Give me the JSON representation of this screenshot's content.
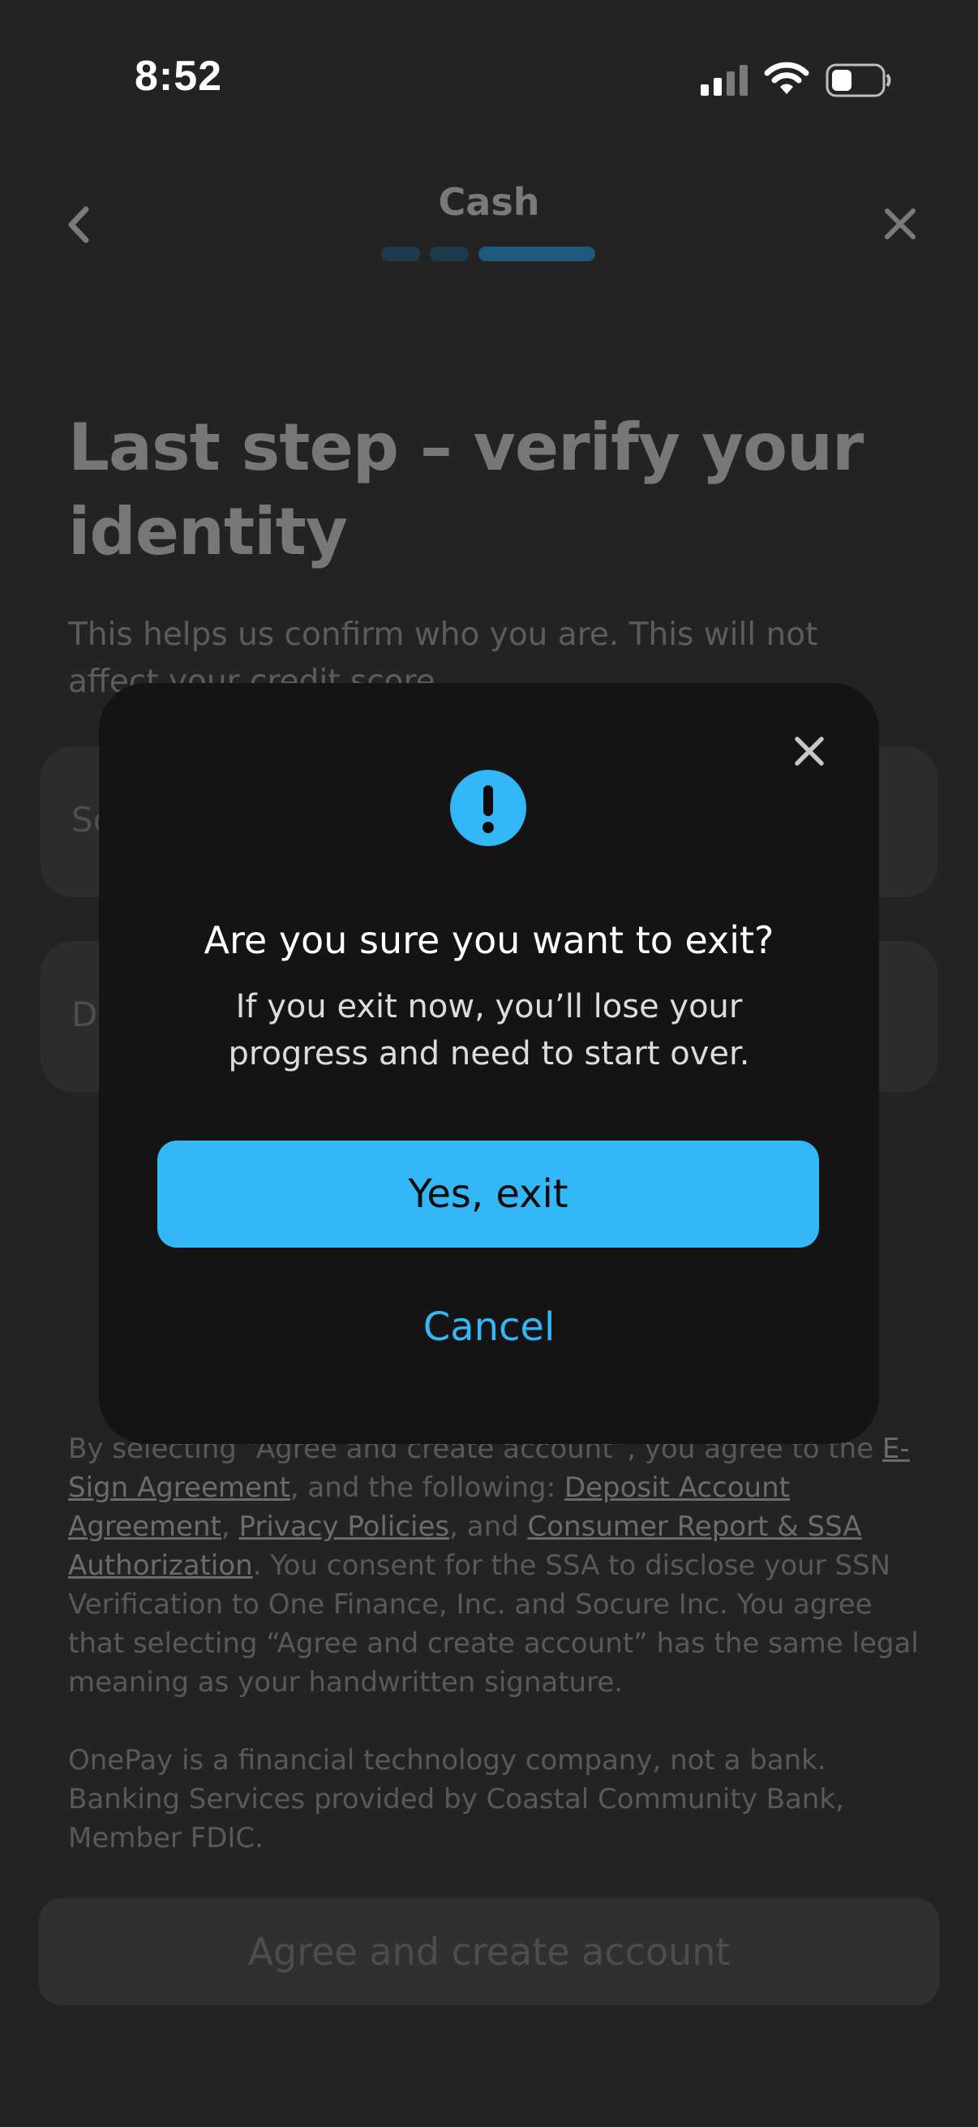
{
  "status_bar": {
    "time": "8:52"
  },
  "header": {
    "title": "Cash",
    "back_icon": "chevron-left-icon",
    "close_icon": "close-icon",
    "progress_steps": 3,
    "current_step": 3
  },
  "page": {
    "heading": "Last step – verify your identity",
    "subtitle": "This helps us confirm who you are. This will not affect your credit score.",
    "fields": [
      {
        "placeholder_visible": "So"
      },
      {
        "placeholder_visible": "Da"
      }
    ],
    "legal": {
      "intro": "By selecting “Agree and create account”, you agree to the ",
      "link_esign": "E-Sign Agreement",
      "mid1": ", and the following: ",
      "link_deposit": "Deposit Account Agreement",
      "mid2": ", ",
      "link_privacy": "Privacy Policies",
      "mid3": ", and ",
      "link_consumer": "Consumer Report & SSA Authorization",
      "outro": ". You consent for the SSA to disclose your SSN Verification to One Finance, Inc. and Socure Inc. You agree that selecting “Agree and create account” has the same legal meaning as your handwritten signature."
    },
    "disclaimer": "OnePay is a financial technology company, not a bank. Banking Services provided by Coastal Community Bank, Member FDIC.",
    "agree_button": "Agree and create account"
  },
  "modal": {
    "title": "Are you sure you want to exit?",
    "message": "If you exit now, you’ll lose your progress and need to start over.",
    "confirm_button": "Yes, exit",
    "cancel_button": "Cancel",
    "icon": "exclamation-circle-icon",
    "accent_color": "#33b7f7"
  }
}
